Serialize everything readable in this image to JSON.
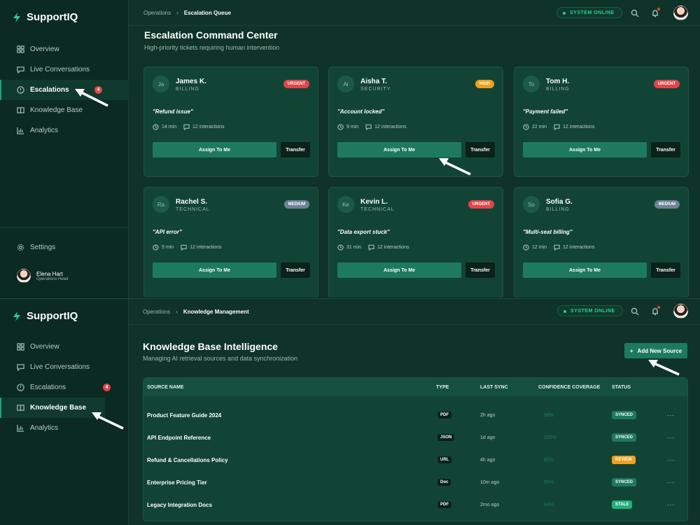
{
  "app": {
    "name": "SupportIQ"
  },
  "nav": {
    "items": [
      {
        "label": "Overview"
      },
      {
        "label": "Live Conversations"
      },
      {
        "label": "Escalations",
        "badge": "4"
      },
      {
        "label": "Knowledge Base"
      },
      {
        "label": "Analytics"
      }
    ],
    "settings": "Settings"
  },
  "user": {
    "name": "Elena Hart",
    "role": "Operations Head"
  },
  "status": "SYSTEM ONLINE",
  "escalation_view": {
    "breadcrumb": {
      "parent": "Operations",
      "current": "Escalation Queue"
    },
    "title": "Escalation Command Center",
    "subtitle": "High-priority tickets requiring human intervention",
    "assign_label": "Assign To Me",
    "transfer_label": "Transfer",
    "tickets": [
      {
        "initials": "Ja",
        "name": "James K.",
        "dept": "BILLING",
        "priority": "URGENT",
        "issue": "\"Refund issue\"",
        "time": "14 min",
        "interactions": "12 interactions"
      },
      {
        "initials": "Ai",
        "name": "Aisha T.",
        "dept": "SECURITY",
        "priority": "HIGH",
        "issue": "\"Account locked\"",
        "time": "9 min",
        "interactions": "12 interactions"
      },
      {
        "initials": "To",
        "name": "Tom H.",
        "dept": "BILLING",
        "priority": "URGENT",
        "issue": "\"Payment failed\"",
        "time": "22 min",
        "interactions": "12 interactions"
      },
      {
        "initials": "Ra",
        "name": "Rachel S.",
        "dept": "TECHNICAL",
        "priority": "MEDIUM",
        "issue": "\"API error\"",
        "time": "5 min",
        "interactions": "12 interactions"
      },
      {
        "initials": "Ke",
        "name": "Kevin L.",
        "dept": "TECHNICAL",
        "priority": "URGENT",
        "issue": "\"Data export stuck\"",
        "time": "31 min",
        "interactions": "12 interactions"
      },
      {
        "initials": "So",
        "name": "Sofia G.",
        "dept": "BILLING",
        "priority": "MEDIUM",
        "issue": "\"Multi-seat billing\"",
        "time": "12 min",
        "interactions": "12 interactions"
      }
    ]
  },
  "knowledge_view": {
    "breadcrumb": {
      "parent": "Operations",
      "current": "Knowledge Management"
    },
    "title": "Knowledge Base Intelligence",
    "subtitle": "Managing AI retrieval sources and data synchronization",
    "add_button": "Add New Source",
    "columns": [
      "SOURCE NAME",
      "TYPE",
      "LAST SYNC",
      "CONFIDENCE COVERAGE",
      "STATUS"
    ],
    "rows": [
      {
        "name": "Product Feature Guide 2024",
        "type": "PDF",
        "sync": "2h ago",
        "coverage": "98%",
        "status": "SYNCED"
      },
      {
        "name": "API Endpoint Reference",
        "type": "JSON",
        "sync": "1d ago",
        "coverage": "100%",
        "status": "SYNCED"
      },
      {
        "name": "Refund & Cancellations Policy",
        "type": "URL",
        "sync": "4h ago",
        "coverage": "82%",
        "status": "REVIEW"
      },
      {
        "name": "Enterprise Pricing Tier",
        "type": "Doc",
        "sync": "10m ago",
        "coverage": "95%",
        "status": "SYNCED"
      },
      {
        "name": "Legacy Integration Docs",
        "type": "PDF",
        "sync": "2mo ago",
        "coverage": "64%",
        "status": "STALE"
      }
    ],
    "more": "···"
  },
  "colors": {
    "urgent": "#e0454a",
    "high": "#f0a020",
    "medium": "#6f8296",
    "synced": "#1d7a5e",
    "review": "#f0a020",
    "stale": "#22b07d"
  }
}
